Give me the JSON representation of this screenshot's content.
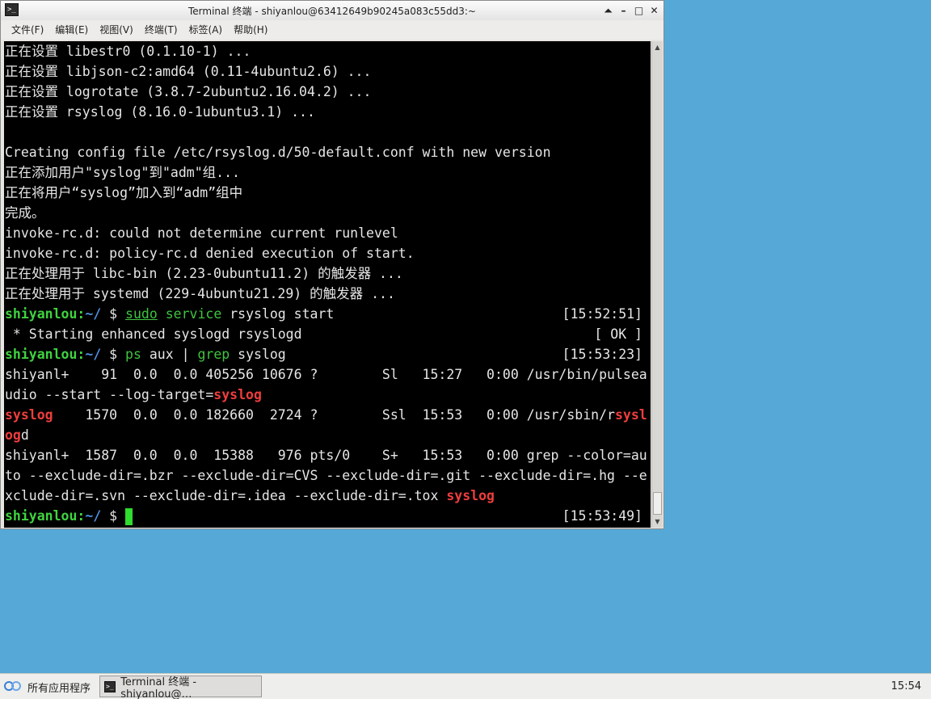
{
  "window": {
    "title": "Terminal 终端 - shiyanlou@63412649b90245a083c55dd3:~",
    "controls": [
      "⏶",
      "–",
      "□",
      "✕"
    ]
  },
  "menu": [
    "文件(F)",
    "编辑(E)",
    "视图(V)",
    "终端(T)",
    "标签(A)",
    "帮助(H)"
  ],
  "terminal": {
    "lines": [
      "正在设置 libestr0 (0.1.10-1) ...",
      "正在设置 libjson-c2:amd64 (0.11-4ubuntu2.6) ...",
      "正在设置 logrotate (3.8.7-2ubuntu2.16.04.2) ...",
      "正在设置 rsyslog (8.16.0-1ubuntu3.1) ...",
      "",
      "Creating config file /etc/rsyslog.d/50-default.conf with new version",
      "正在添加用户\"syslog\"到\"adm\"组...",
      "正在将用户“syslog”加入到“adm”组中",
      "完成。",
      "invoke-rc.d: could not determine current runlevel",
      "invoke-rc.d: policy-rc.d denied execution of start.",
      "正在处理用于 libc-bin (2.23-0ubuntu11.2) 的触发器 ...",
      "正在处理用于 systemd (229-4ubuntu21.29) 的触发器 ..."
    ],
    "prompt_user": "shiyanlou",
    "prompt_sep": ":",
    "prompt_path": "~/",
    "prompt_dollar": " $ ",
    "cmd1": {
      "a": "sudo",
      "b": "service",
      "rest": " rsyslog start",
      "ts": "[15:52:51]"
    },
    "starting": " * Starting enhanced syslogd rsyslogd",
    "ok": "[ OK ]",
    "cmd2": {
      "a": "ps",
      "mid": " aux | ",
      "b": "grep",
      "rest": " syslog",
      "ts": "[15:53:23]"
    },
    "ps": {
      "row1a": "shiyanl+    91  0.0  0.0 405256 10676 ?        Sl   15:27   0:00 /usr/bin/pulsea",
      "row1b": "udio --start --log-target=",
      "row1b_hl": "syslog",
      "row2_hl": "syslog",
      "row2": "    1570  0.0  0.0 182660  2724 ?        Ssl  15:53   0:00 /usr/sbin/r",
      "row2_hl2": "sysl",
      "row3_hl": "og",
      "row3": "d",
      "row4": "shiyanl+  1587  0.0  0.0  15388   976 pts/0    S+   15:53   0:00 grep --color=au",
      "row5": "to --exclude-dir=.bzr --exclude-dir=CVS --exclude-dir=.git --exclude-dir=.hg --e",
      "row6": "xclude-dir=.svn --exclude-dir=.idea --exclude-dir=.tox ",
      "row6_hl": "syslog"
    },
    "last_ts": "[15:53:49]"
  },
  "taskbar": {
    "start_label": "所有应用程序",
    "task_label": "Terminal 终端 - shiyanlou@…",
    "clock": "15:54"
  }
}
